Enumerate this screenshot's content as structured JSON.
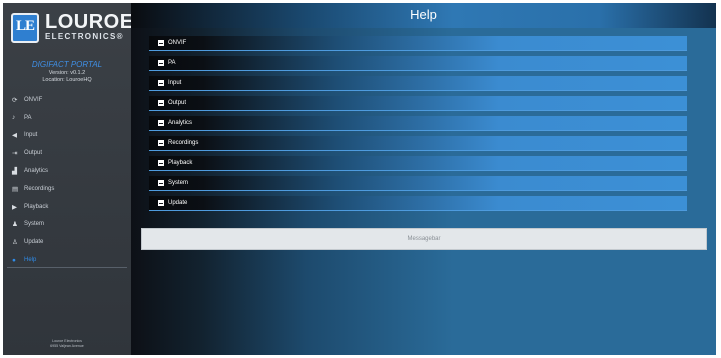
{
  "brand": {
    "name": "LOUROE",
    "tagline": "ELECTRONICS®",
    "mark": "LE"
  },
  "portal": {
    "title": "DIGIFACT PORTAL",
    "version": "Version: v0.1.2",
    "location": "Location: LouroeHQ"
  },
  "sidebar": {
    "items": [
      {
        "label": "ONVIF",
        "icon": "refresh-icon",
        "glyph": "⟳"
      },
      {
        "label": "PA",
        "icon": "microphone-icon",
        "glyph": "♪"
      },
      {
        "label": "Input",
        "icon": "speaker-icon",
        "glyph": "◀"
      },
      {
        "label": "Output",
        "icon": "signout-icon",
        "glyph": "⇥"
      },
      {
        "label": "Analytics",
        "icon": "chart-icon",
        "glyph": "▟"
      },
      {
        "label": "Recordings",
        "icon": "file-icon",
        "glyph": "▤"
      },
      {
        "label": "Playback",
        "icon": "play-icon",
        "glyph": "▶"
      },
      {
        "label": "System",
        "icon": "users-cog-icon",
        "glyph": "♟"
      },
      {
        "label": "Update",
        "icon": "user-icon",
        "glyph": "♙"
      },
      {
        "label": "Help",
        "icon": "question-icon",
        "glyph": "●",
        "active": true
      }
    ],
    "footer": [
      "Louroe Electronics",
      "6955 Valjean Avenue"
    ]
  },
  "main": {
    "title": "Help",
    "sections": [
      "ONVIF",
      "PA",
      "Input",
      "Output",
      "Analytics",
      "Recordings",
      "Playback",
      "System",
      "Update"
    ],
    "message_bar": "Messagebar"
  },
  "colors": {
    "accent": "#2f8be8",
    "title_bar": "#2f78b4"
  }
}
